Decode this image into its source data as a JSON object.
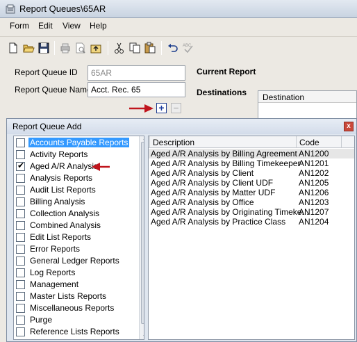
{
  "window": {
    "title": "Report Queues\\65AR"
  },
  "menu": [
    "Form",
    "Edit",
    "View",
    "Help"
  ],
  "toolbar_icons": [
    "new-icon",
    "open-icon",
    "save-icon",
    "print-icon",
    "print-preview-icon",
    "upload-icon",
    "cut-icon",
    "copy-icon",
    "paste-icon",
    "undo-icon",
    "spellcheck-icon"
  ],
  "form": {
    "queue_id_label": "Report Queue ID",
    "queue_id_value": "65AR",
    "queue_name_label": "Report Queue Name",
    "queue_name_value": "Acct. Rec. 65",
    "current_report_label": "Current Report",
    "destinations_label": "Destinations",
    "destination_col": "Destination"
  },
  "dialog": {
    "title": "Report Queue Add",
    "close": "x",
    "categories": [
      {
        "label": "Accounts Payable Reports",
        "checked": false,
        "selected": true
      },
      {
        "label": "Activity Reports",
        "checked": false,
        "selected": false
      },
      {
        "label": "Aged A/R Analysis",
        "checked": true,
        "selected": false
      },
      {
        "label": "Analysis Reports",
        "checked": false,
        "selected": false
      },
      {
        "label": "Audit List Reports",
        "checked": false,
        "selected": false
      },
      {
        "label": "Billing Analysis",
        "checked": false,
        "selected": false
      },
      {
        "label": "Collection Analysis",
        "checked": false,
        "selected": false
      },
      {
        "label": "Combined Analysis",
        "checked": false,
        "selected": false
      },
      {
        "label": "Edit List Reports",
        "checked": false,
        "selected": false
      },
      {
        "label": "Error Reports",
        "checked": false,
        "selected": false
      },
      {
        "label": "General Ledger Reports",
        "checked": false,
        "selected": false
      },
      {
        "label": "Log Reports",
        "checked": false,
        "selected": false
      },
      {
        "label": "Management",
        "checked": false,
        "selected": false
      },
      {
        "label": "Master Lists Reports",
        "checked": false,
        "selected": false
      },
      {
        "label": "Miscellaneous Reports",
        "checked": false,
        "selected": false
      },
      {
        "label": "Purge",
        "checked": false,
        "selected": false
      },
      {
        "label": "Reference Lists Reports",
        "checked": false,
        "selected": false
      }
    ],
    "grid": {
      "col_description": "Description",
      "col_code": "Code",
      "rows": [
        {
          "description": "Aged A/R Analysis by Billing Agreement",
          "code": "AN1200"
        },
        {
          "description": "Aged A/R Analysis by Billing Timekeeper",
          "code": "AN1201"
        },
        {
          "description": "Aged A/R Analysis by Client",
          "code": "AN1202"
        },
        {
          "description": "Aged A/R Analysis by Client UDF",
          "code": "AN1205"
        },
        {
          "description": "Aged A/R Analysis by Matter UDF",
          "code": "AN1206"
        },
        {
          "description": "Aged A/R Analysis by Office",
          "code": "AN1203"
        },
        {
          "description": "Aged A/R Analysis by Originating Timeke...",
          "code": "AN1207"
        },
        {
          "description": "Aged A/R Analysis by Practice Class",
          "code": "AN1204"
        }
      ]
    }
  }
}
